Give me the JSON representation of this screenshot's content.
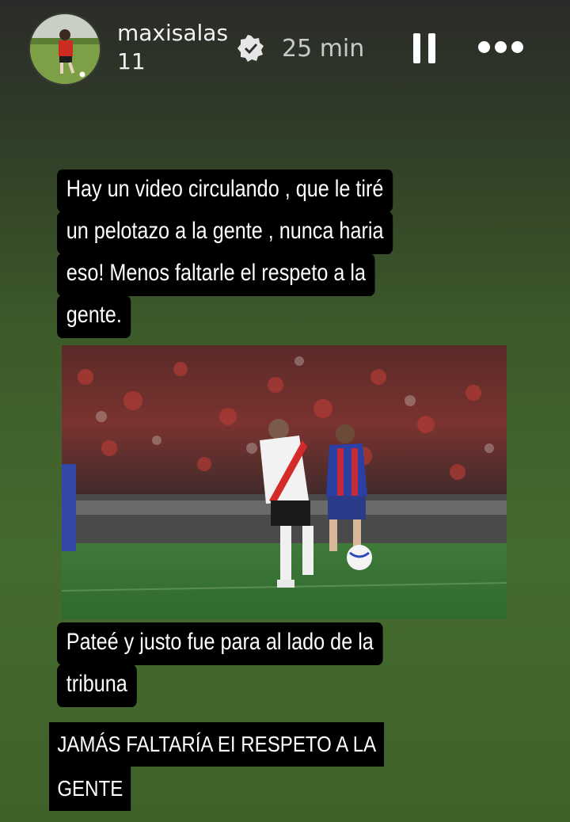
{
  "story": {
    "username": "maxisalas11",
    "timestamp": "25 min",
    "icons": {
      "verified": "verified-badge-icon",
      "pause": "pause-icon",
      "more": "more-options-icon"
    }
  },
  "caption_top": {
    "lines": [
      "Hay un video circulando  , que le tiré",
      "un pelotazo a la gente , nunca haria",
      "eso! Menos faltarle el respeto a la",
      "gente."
    ]
  },
  "caption_bottom": {
    "lines": [
      "Pateé y justo fue para al lado de la",
      "tribuna"
    ]
  },
  "caption_caps": {
    "lines": [
      "JAMÁS FALTARÍA EI RESPETO A LA",
      "GENTE"
    ]
  },
  "colors": {
    "caption_bg": "#000000",
    "text": "#ffffff",
    "background_top": "#2b2b29",
    "background_bottom": "#3f6229"
  }
}
